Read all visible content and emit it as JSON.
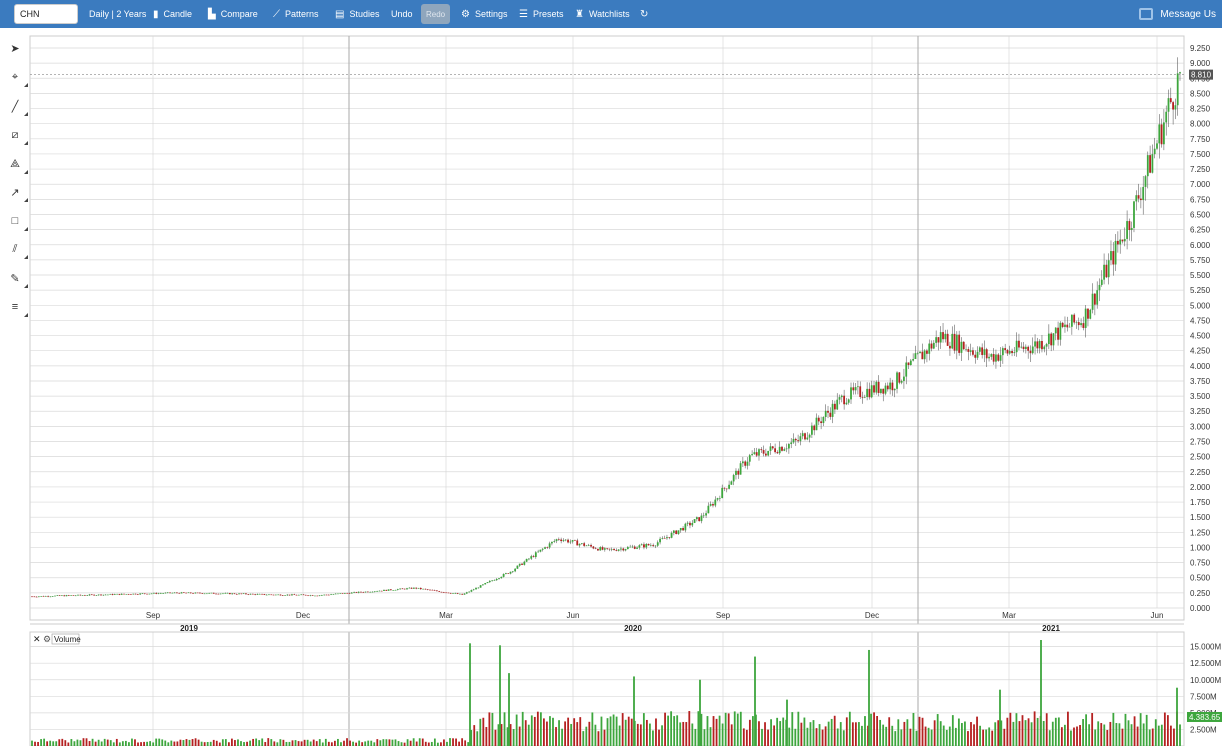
{
  "toolbar": {
    "symbol": "CHN",
    "range": "Daily | 2 Years",
    "candle": "Candle",
    "compare": "Compare",
    "patterns": "Patterns",
    "studies": "Studies",
    "undo": "Undo",
    "redo": "Redo",
    "settings": "Settings",
    "presets": "Presets",
    "watchlists": "Watchlists",
    "message": "Message Us"
  },
  "tools": [
    "cursor-icon",
    "crosshair-icon",
    "line-icon",
    "channel-icon",
    "fan-icon",
    "arrow-icon",
    "rectangle-icon",
    "parallel-lines-icon",
    "brush-icon",
    "text-list-icon"
  ],
  "colors": {
    "up": "#3da63d",
    "down": "#b52020",
    "grid": "#d9d9d9",
    "bar": "#3b7bbf"
  },
  "chart_data": [
    {
      "type": "candlestick",
      "title": "",
      "price_axis": [
        "9.250",
        "9.000",
        "8.750",
        "8.500",
        "8.250",
        "8.000",
        "7.750",
        "7.500",
        "7.250",
        "7.000",
        "6.750",
        "6.500",
        "6.250",
        "6.000",
        "5.750",
        "5.500",
        "5.250",
        "5.000",
        "4.750",
        "4.500",
        "4.250",
        "4.000",
        "3.750",
        "3.500",
        "3.250",
        "3.000",
        "2.750",
        "2.500",
        "2.250",
        "2.000",
        "1.750",
        "1.500",
        "1.250",
        "1.000",
        "0.750",
        "0.500",
        "0.250",
        "0.000"
      ],
      "ylim": [
        0,
        9.25
      ],
      "last_price": "8.810",
      "month_labels": [
        "Sep",
        "Dec",
        "Mar",
        "Jun",
        "Sep",
        "Dec",
        "Mar",
        "Jun"
      ],
      "year_labels": [
        "2019",
        "2020",
        "2021"
      ],
      "x": [
        "2019-06",
        "2019-07",
        "2019-08",
        "2019-09",
        "2019-10",
        "2019-11",
        "2019-12",
        "2020-01",
        "2020-02",
        "2020-03",
        "2020-04",
        "2020-05",
        "2020-06",
        "2020-07",
        "2020-08",
        "2020-09",
        "2020-10",
        "2020-11",
        "2020-12",
        "2021-01",
        "2021-02",
        "2021-03",
        "2021-04",
        "2021-05",
        "2021-06"
      ],
      "close": [
        0.19,
        0.21,
        0.23,
        0.25,
        0.24,
        0.22,
        0.21,
        0.27,
        0.33,
        0.22,
        0.6,
        1.15,
        0.95,
        1.05,
        1.5,
        2.5,
        2.75,
        3.5,
        3.7,
        4.5,
        4.15,
        4.35,
        4.8,
        6.5,
        8.81
      ]
    },
    {
      "type": "bar",
      "title": "Volume",
      "volume_axis": [
        "15.000M",
        "12.500M",
        "10.000M",
        "7.500M",
        "5.000M",
        "2.500M"
      ],
      "ylim": [
        0,
        16000000
      ],
      "last_volume": "4.383.65",
      "peaks_m": [
        15.5,
        15.2,
        11.0,
        10.5,
        10.0,
        13.5,
        7.0,
        14.5,
        8.5,
        16.0,
        8.8
      ]
    }
  ]
}
